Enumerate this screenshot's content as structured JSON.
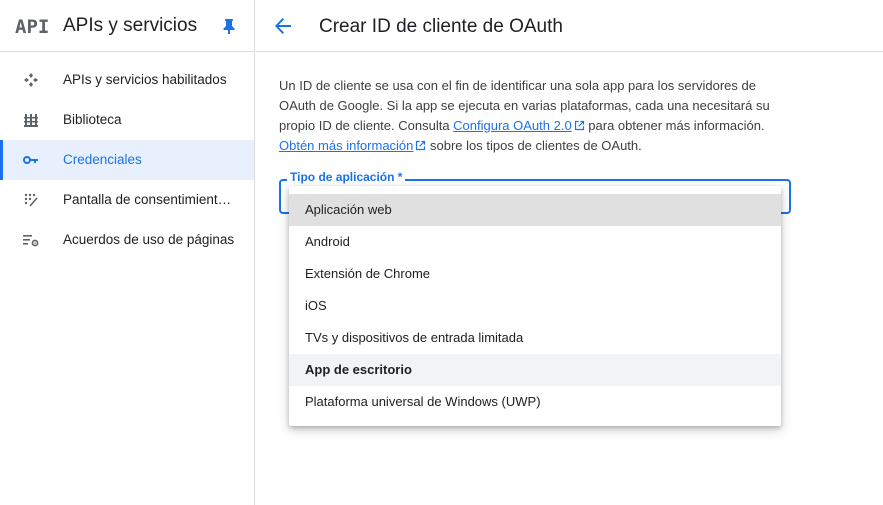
{
  "sidebar": {
    "logo": "API",
    "title": "APIs y servicios",
    "items": [
      {
        "label": "APIs y servicios habilitados",
        "icon": "api-dashboard-icon"
      },
      {
        "label": "Biblioteca",
        "icon": "library-icon"
      },
      {
        "label": "Credenciales",
        "icon": "key-icon",
        "active": true
      },
      {
        "label": "Pantalla de consentimiento de OAuth",
        "icon": "consent-screen-icon"
      },
      {
        "label": "Acuerdos de uso de páginas",
        "icon": "page-settings-icon"
      }
    ]
  },
  "header": {
    "title": "Crear ID de cliente de OAuth"
  },
  "description": {
    "part1": "Un ID de cliente se usa con el fin de identificar una sola app para los servidores de OAuth de Google. Si la app se ejecuta en varias plataformas, cada una necesitará su propio ID de cliente. Consulta ",
    "link1": "Configura OAuth 2.0",
    "part2": " para obtener más información. ",
    "link2": "Obtén más información",
    "part3": " sobre los tipos de clientes de OAuth."
  },
  "field": {
    "label": "Tipo de aplicación *"
  },
  "dropdown": {
    "options": [
      "Aplicación web",
      "Android",
      "Extensión de Chrome",
      "iOS",
      "TVs y dispositivos de entrada limitada",
      "App de escritorio",
      "Plataforma universal de Windows (UWP)"
    ],
    "selected_index": 0,
    "hover_index": 5
  },
  "colors": {
    "accent": "#1a73e8",
    "active_bg": "#e8f0fe",
    "icon_gray": "#5f6368"
  }
}
